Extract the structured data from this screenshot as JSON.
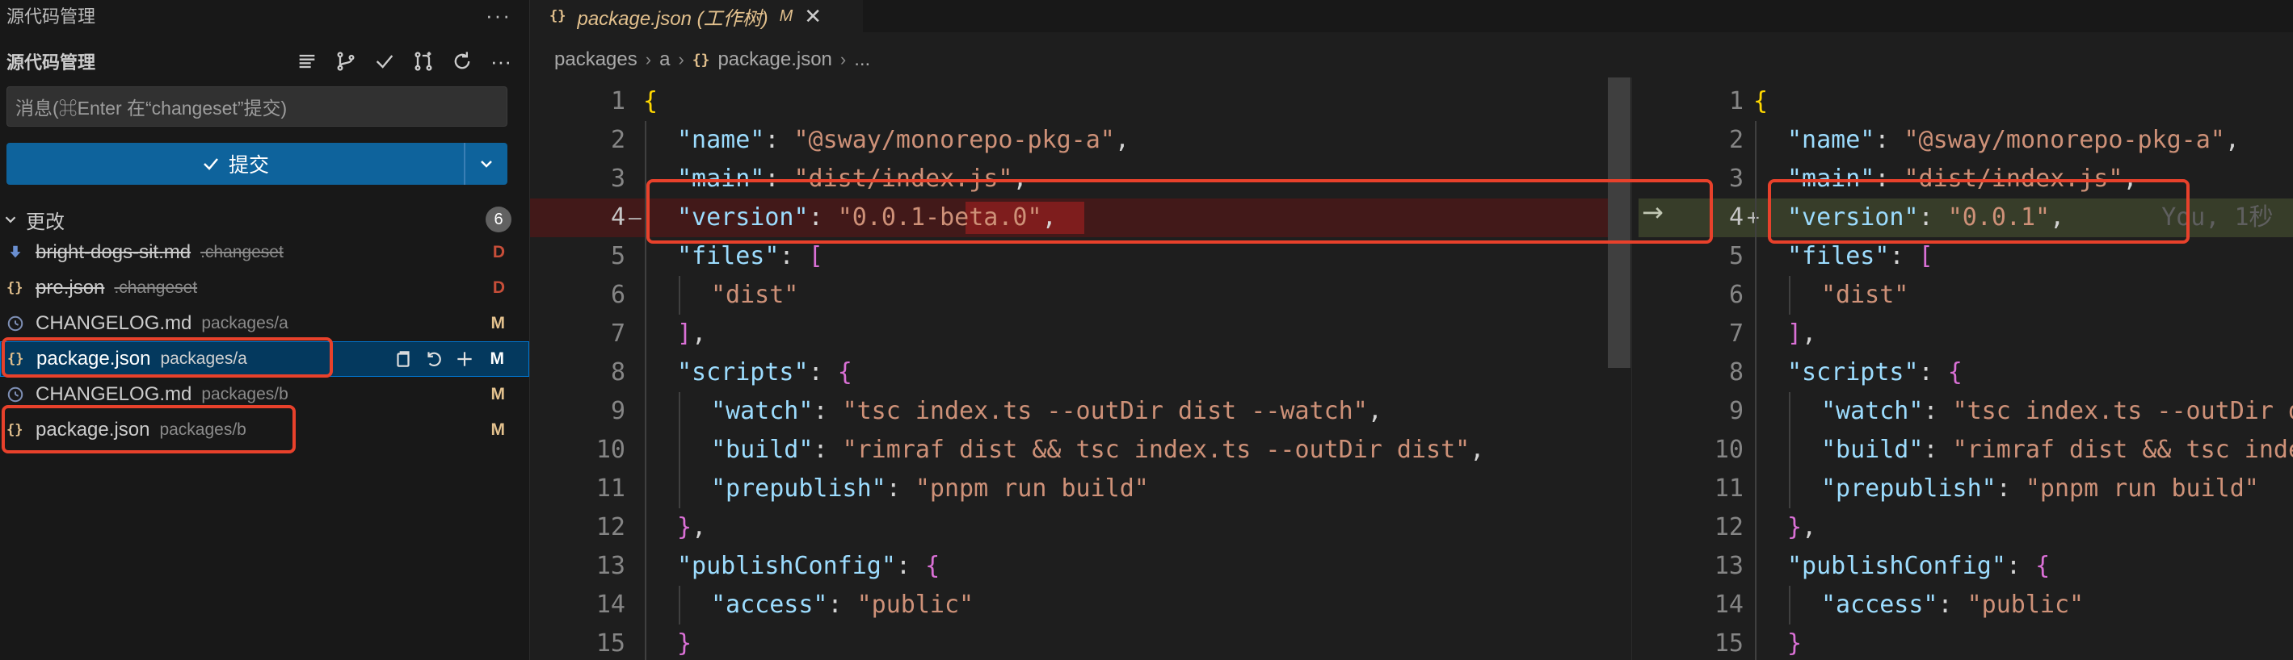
{
  "sidebar": {
    "view_title": "源代码管理",
    "more_label": "···",
    "scm_title": "源代码管理",
    "commit_placeholder": "消息(⌘Enter 在“changeset”提交)",
    "commit_label": "提交",
    "changes_label": "更改",
    "changes_count": "6",
    "files": [
      {
        "name": "bright-dogs-sit.md",
        "dir": ".changeset",
        "status": "D",
        "icon": "download-icon",
        "deleted": true
      },
      {
        "name": "pre.json",
        "dir": ".changeset",
        "status": "D",
        "icon": "json-icon",
        "deleted": true
      },
      {
        "name": "CHANGELOG.md",
        "dir": "packages/a",
        "status": "M",
        "icon": "info-icon",
        "deleted": false
      },
      {
        "name": "package.json",
        "dir": "packages/a",
        "status": "M",
        "icon": "json-icon",
        "deleted": false,
        "selected": true
      },
      {
        "name": "CHANGELOG.md",
        "dir": "packages/b",
        "status": "M",
        "icon": "info-icon",
        "deleted": false
      },
      {
        "name": "package.json",
        "dir": "packages/b",
        "status": "M",
        "icon": "json-icon",
        "deleted": false
      }
    ],
    "status_colors": {
      "D": "#c74e39",
      "M": "#e2c08d"
    }
  },
  "tab": {
    "icon_text": "{}",
    "title": "package.json (工作树)",
    "modified": "M",
    "close": "✕"
  },
  "breadcrumb": [
    "packages",
    "a",
    "package.json",
    "..."
  ],
  "breadcrumb_icon": "{}",
  "diff_arrow": "→",
  "blame_text": "You, 1秒",
  "left_lines": [
    {
      "n": "1",
      "indent": 0,
      "tokens": [
        [
          "b1",
          "{"
        ]
      ]
    },
    {
      "n": "2",
      "indent": 1,
      "tokens": [
        [
          "k",
          "\"name\""
        ],
        [
          "p",
          ": "
        ],
        [
          "s",
          "\"@sway/monorepo-pkg-a\""
        ],
        [
          "p",
          ","
        ]
      ]
    },
    {
      "n": "3",
      "indent": 1,
      "tokens": [
        [
          "k",
          "\"main\""
        ],
        [
          "p",
          ": "
        ],
        [
          "s",
          "\"dist/index.js\""
        ],
        [
          "p",
          ","
        ]
      ]
    },
    {
      "n": "4",
      "indent": 1,
      "marker": "—",
      "tokens": [
        [
          "k",
          "\"version\""
        ],
        [
          "p",
          ": "
        ],
        [
          "s",
          "\"0.0.1-beta.0\""
        ],
        [
          "p",
          ","
        ]
      ]
    },
    {
      "n": "5",
      "indent": 1,
      "tokens": [
        [
          "k",
          "\"files\""
        ],
        [
          "p",
          ": "
        ],
        [
          "b2",
          "["
        ]
      ]
    },
    {
      "n": "6",
      "indent": 2,
      "tokens": [
        [
          "s",
          "\"dist\""
        ]
      ]
    },
    {
      "n": "7",
      "indent": 1,
      "tokens": [
        [
          "b2",
          "]"
        ],
        [
          "p",
          ","
        ]
      ]
    },
    {
      "n": "8",
      "indent": 1,
      "tokens": [
        [
          "k",
          "\"scripts\""
        ],
        [
          "p",
          ": "
        ],
        [
          "b2",
          "{"
        ]
      ]
    },
    {
      "n": "9",
      "indent": 2,
      "tokens": [
        [
          "k",
          "\"watch\""
        ],
        [
          "p",
          ": "
        ],
        [
          "s",
          "\"tsc index.ts --outDir dist --watch\""
        ],
        [
          "p",
          ","
        ]
      ]
    },
    {
      "n": "10",
      "indent": 2,
      "tokens": [
        [
          "k",
          "\"build\""
        ],
        [
          "p",
          ": "
        ],
        [
          "s",
          "\"rimraf dist && tsc index.ts --outDir dist\""
        ],
        [
          "p",
          ","
        ]
      ]
    },
    {
      "n": "11",
      "indent": 2,
      "tokens": [
        [
          "k",
          "\"prepublish\""
        ],
        [
          "p",
          ": "
        ],
        [
          "s",
          "\"pnpm run build\""
        ]
      ]
    },
    {
      "n": "12",
      "indent": 1,
      "tokens": [
        [
          "b2",
          "}"
        ],
        [
          "p",
          ","
        ]
      ]
    },
    {
      "n": "13",
      "indent": 1,
      "tokens": [
        [
          "k",
          "\"publishConfig\""
        ],
        [
          "p",
          ": "
        ],
        [
          "b2",
          "{"
        ]
      ]
    },
    {
      "n": "14",
      "indent": 2,
      "tokens": [
        [
          "k",
          "\"access\""
        ],
        [
          "p",
          ": "
        ],
        [
          "s",
          "\"public\""
        ]
      ]
    },
    {
      "n": "15",
      "indent": 1,
      "tokens": [
        [
          "b2",
          "}"
        ]
      ]
    }
  ],
  "right_lines": [
    {
      "n": "1",
      "indent": 0,
      "tokens": [
        [
          "b1",
          "{"
        ]
      ]
    },
    {
      "n": "2",
      "indent": 1,
      "tokens": [
        [
          "k",
          "\"name\""
        ],
        [
          "p",
          ": "
        ],
        [
          "s",
          "\"@sway/monorepo-pkg-a\""
        ],
        [
          "p",
          ","
        ]
      ]
    },
    {
      "n": "3",
      "indent": 1,
      "tokens": [
        [
          "k",
          "\"main\""
        ],
        [
          "p",
          ": "
        ],
        [
          "s",
          "\"dist/index.js\""
        ],
        [
          "p",
          ","
        ]
      ]
    },
    {
      "n": "4",
      "indent": 1,
      "marker": "+",
      "tokens": [
        [
          "k",
          "\"version\""
        ],
        [
          "p",
          ": "
        ],
        [
          "s",
          "\"0.0.1\""
        ],
        [
          "p",
          ","
        ]
      ]
    },
    {
      "n": "5",
      "indent": 1,
      "tokens": [
        [
          "k",
          "\"files\""
        ],
        [
          "p",
          ": "
        ],
        [
          "b2",
          "["
        ]
      ]
    },
    {
      "n": "6",
      "indent": 2,
      "tokens": [
        [
          "s",
          "\"dist\""
        ]
      ]
    },
    {
      "n": "7",
      "indent": 1,
      "tokens": [
        [
          "b2",
          "]"
        ],
        [
          "p",
          ","
        ]
      ]
    },
    {
      "n": "8",
      "indent": 1,
      "tokens": [
        [
          "k",
          "\"scripts\""
        ],
        [
          "p",
          ": "
        ],
        [
          "b2",
          "{"
        ]
      ]
    },
    {
      "n": "9",
      "indent": 2,
      "tokens": [
        [
          "k",
          "\"watch\""
        ],
        [
          "p",
          ": "
        ],
        [
          "s",
          "\"tsc index.ts --outDir dist --watch\""
        ],
        [
          "p",
          ","
        ]
      ]
    },
    {
      "n": "10",
      "indent": 2,
      "tokens": [
        [
          "k",
          "\"build\""
        ],
        [
          "p",
          ": "
        ],
        [
          "s",
          "\"rimraf dist && tsc index.ts --outDir dist\""
        ],
        [
          "p",
          ","
        ]
      ]
    },
    {
      "n": "11",
      "indent": 2,
      "tokens": [
        [
          "k",
          "\"prepublish\""
        ],
        [
          "p",
          ": "
        ],
        [
          "s",
          "\"pnpm run build\""
        ]
      ]
    },
    {
      "n": "12",
      "indent": 1,
      "tokens": [
        [
          "b2",
          "}"
        ],
        [
          "p",
          ","
        ]
      ]
    },
    {
      "n": "13",
      "indent": 1,
      "tokens": [
        [
          "k",
          "\"publishConfig\""
        ],
        [
          "p",
          ": "
        ],
        [
          "b2",
          "{"
        ]
      ]
    },
    {
      "n": "14",
      "indent": 2,
      "tokens": [
        [
          "k",
          "\"access\""
        ],
        [
          "p",
          ": "
        ],
        [
          "s",
          "\"public\""
        ]
      ]
    },
    {
      "n": "15",
      "indent": 1,
      "tokens": [
        [
          "b2",
          "}"
        ]
      ]
    }
  ]
}
